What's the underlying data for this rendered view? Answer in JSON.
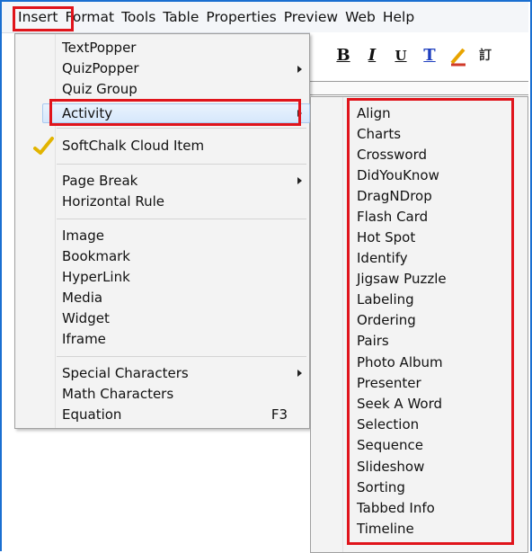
{
  "menubar": {
    "items": [
      "Insert",
      "Format",
      "Tools",
      "Table",
      "Properties",
      "Preview",
      "Web",
      "Help"
    ]
  },
  "toolbar": {
    "bold": "B",
    "italic": "I",
    "underline": "U",
    "text_color": "T",
    "highlight_icon": "highlighter-icon"
  },
  "insert_menu": {
    "items": [
      {
        "label": "TextPopper"
      },
      {
        "label": "QuizPopper",
        "submenu": true
      },
      {
        "label": "Quiz Group"
      },
      {
        "label": "Activity",
        "submenu": true,
        "highlighted": true
      },
      {
        "label": "SoftChalk Cloud Item",
        "icon": "checkmark-icon"
      },
      {
        "label": "Page Break",
        "submenu": true
      },
      {
        "label": "Horizontal Rule"
      },
      {
        "label": "Image"
      },
      {
        "label": "Bookmark"
      },
      {
        "label": "HyperLink"
      },
      {
        "label": "Media"
      },
      {
        "label": "Widget"
      },
      {
        "label": "Iframe"
      },
      {
        "label": "Special Characters",
        "submenu": true
      },
      {
        "label": "Math Characters"
      },
      {
        "label": "Equation",
        "shortcut": "F3"
      }
    ]
  },
  "activity_submenu": {
    "items": [
      "Align",
      "Charts",
      "Crossword",
      "DidYouKnow",
      "DragNDrop",
      "Flash Card",
      "Hot Spot",
      "Identify",
      "Jigsaw Puzzle",
      "Labeling",
      "Ordering",
      "Pairs",
      "Photo Album",
      "Presenter",
      "Seek A Word",
      "Selection",
      "Sequence",
      "Slideshow",
      "Sorting",
      "Tabbed Info",
      "Timeline"
    ]
  },
  "colors": {
    "frame": "#1a6fd1",
    "highlight_box": "#e0141b",
    "hover": "#d6e7fb"
  }
}
